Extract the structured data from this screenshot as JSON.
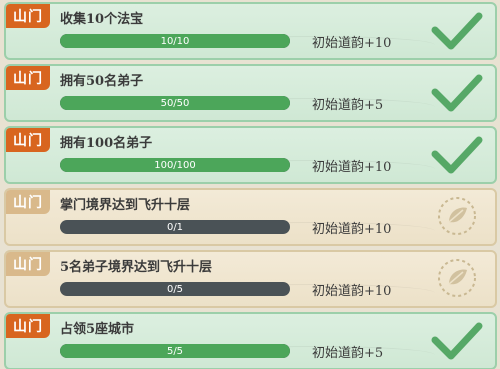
{
  "colors": {
    "done_tag": "#d8651f",
    "todo_tag": "#d9b98b",
    "bar_fill": "#4ca65a",
    "bar_track": "#4a5256",
    "check_done": "#3f9c52",
    "check_todo": "#c9b892"
  },
  "quests": [
    {
      "tag": "山门",
      "title": "收集10个法宝",
      "progress_text": "10/10",
      "progress": 1.0,
      "reward": "初始道韵+10",
      "status": "completed",
      "icon": "checkmark-icon"
    },
    {
      "tag": "山门",
      "title": "拥有50名弟子",
      "progress_text": "50/50",
      "progress": 1.0,
      "reward": "初始道韵+5",
      "status": "completed",
      "icon": "checkmark-icon"
    },
    {
      "tag": "山门",
      "title": "拥有100名弟子",
      "progress_text": "100/100",
      "progress": 1.0,
      "reward": "初始道韵+10",
      "status": "completed",
      "icon": "checkmark-icon"
    },
    {
      "tag": "山门",
      "title": "掌门境界达到飞升十层",
      "progress_text": "0/1",
      "progress": 0.0,
      "reward": "初始道韵+10",
      "status": "incomplete",
      "icon": "leaf-emblem-icon"
    },
    {
      "tag": "山门",
      "title": "5名弟子境界达到飞升十层",
      "progress_text": "0/5",
      "progress": 0.0,
      "reward": "初始道韵+10",
      "status": "incomplete",
      "icon": "leaf-emblem-icon"
    },
    {
      "tag": "山门",
      "title": "占领5座城市",
      "progress_text": "5/5",
      "progress": 1.0,
      "reward": "初始道韵+5",
      "status": "completed",
      "icon": "checkmark-icon"
    }
  ]
}
